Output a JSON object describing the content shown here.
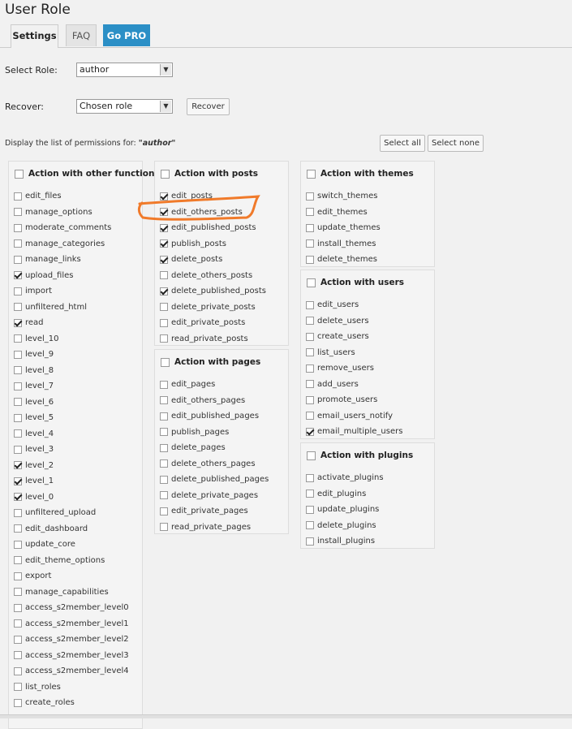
{
  "page": {
    "title": "User Role"
  },
  "tabs": [
    {
      "label": "Settings",
      "active": true
    },
    {
      "label": "FAQ"
    },
    {
      "label": "Go PRO"
    }
  ],
  "form": {
    "role_label": "Select Role:",
    "role_value": "author",
    "recover_label": "Recover:",
    "recover_value": "Chosen role",
    "recover_button": "Recover",
    "select_all": "Select all",
    "select_none": "Select none",
    "hint_prefix": "Display the list of permissions for: ",
    "hint_role": "\"author\""
  },
  "colors": {
    "annotation": "#f07a2a",
    "pro_tab": "#2b8fc6"
  },
  "groups": [
    {
      "title": "Action with other function",
      "items": [
        {
          "label": "edit_files",
          "checked": false
        },
        {
          "label": "manage_options",
          "checked": false
        },
        {
          "label": "moderate_comments",
          "checked": false
        },
        {
          "label": "manage_categories",
          "checked": false
        },
        {
          "label": "manage_links",
          "checked": false
        },
        {
          "label": "upload_files",
          "checked": true
        },
        {
          "label": "import",
          "checked": false
        },
        {
          "label": "unfiltered_html",
          "checked": false
        },
        {
          "label": "read",
          "checked": true
        },
        {
          "label": "level_10",
          "checked": false
        },
        {
          "label": "level_9",
          "checked": false
        },
        {
          "label": "level_8",
          "checked": false
        },
        {
          "label": "level_7",
          "checked": false
        },
        {
          "label": "level_6",
          "checked": false
        },
        {
          "label": "level_5",
          "checked": false
        },
        {
          "label": "level_4",
          "checked": false
        },
        {
          "label": "level_3",
          "checked": false
        },
        {
          "label": "level_2",
          "checked": true
        },
        {
          "label": "level_1",
          "checked": true
        },
        {
          "label": "level_0",
          "checked": true
        },
        {
          "label": "unfiltered_upload",
          "checked": false
        },
        {
          "label": "edit_dashboard",
          "checked": false
        },
        {
          "label": "update_core",
          "checked": false
        },
        {
          "label": "edit_theme_options",
          "checked": false
        },
        {
          "label": "export",
          "checked": false
        },
        {
          "label": "manage_capabilities",
          "checked": false
        },
        {
          "label": "access_s2member_level0",
          "checked": false
        },
        {
          "label": "access_s2member_level1",
          "checked": false
        },
        {
          "label": "access_s2member_level2",
          "checked": false
        },
        {
          "label": "access_s2member_level3",
          "checked": false
        },
        {
          "label": "access_s2member_level4",
          "checked": false
        },
        {
          "label": "list_roles",
          "checked": false
        },
        {
          "label": "create_roles",
          "checked": false
        }
      ]
    },
    {
      "title": "Action with posts",
      "items": [
        {
          "label": "edit_posts",
          "checked": true
        },
        {
          "label": "edit_others_posts",
          "checked": true,
          "highlighted": true
        },
        {
          "label": "edit_published_posts",
          "checked": true
        },
        {
          "label": "publish_posts",
          "checked": true
        },
        {
          "label": "delete_posts",
          "checked": true
        },
        {
          "label": "delete_others_posts",
          "checked": false
        },
        {
          "label": "delete_published_posts",
          "checked": true
        },
        {
          "label": "delete_private_posts",
          "checked": false
        },
        {
          "label": "edit_private_posts",
          "checked": false
        },
        {
          "label": "read_private_posts",
          "checked": false
        }
      ]
    },
    {
      "title": "Action with pages",
      "items": [
        {
          "label": "edit_pages",
          "checked": false
        },
        {
          "label": "edit_others_pages",
          "checked": false
        },
        {
          "label": "edit_published_pages",
          "checked": false
        },
        {
          "label": "publish_pages",
          "checked": false
        },
        {
          "label": "delete_pages",
          "checked": false
        },
        {
          "label": "delete_others_pages",
          "checked": false
        },
        {
          "label": "delete_published_pages",
          "checked": false
        },
        {
          "label": "delete_private_pages",
          "checked": false
        },
        {
          "label": "edit_private_pages",
          "checked": false
        },
        {
          "label": "read_private_pages",
          "checked": false
        }
      ]
    },
    {
      "title": "Action with themes",
      "items": [
        {
          "label": "switch_themes",
          "checked": false
        },
        {
          "label": "edit_themes",
          "checked": false
        },
        {
          "label": "update_themes",
          "checked": false
        },
        {
          "label": "install_themes",
          "checked": false
        },
        {
          "label": "delete_themes",
          "checked": false
        }
      ]
    },
    {
      "title": "Action with users",
      "items": [
        {
          "label": "edit_users",
          "checked": false
        },
        {
          "label": "delete_users",
          "checked": false
        },
        {
          "label": "create_users",
          "checked": false
        },
        {
          "label": "list_users",
          "checked": false
        },
        {
          "label": "remove_users",
          "checked": false
        },
        {
          "label": "add_users",
          "checked": false
        },
        {
          "label": "promote_users",
          "checked": false
        },
        {
          "label": "email_users_notify",
          "checked": false
        },
        {
          "label": "email_multiple_users",
          "checked": true
        }
      ]
    },
    {
      "title": "Action with plugins",
      "items": [
        {
          "label": "activate_plugins",
          "checked": false
        },
        {
          "label": "edit_plugins",
          "checked": false
        },
        {
          "label": "update_plugins",
          "checked": false
        },
        {
          "label": "delete_plugins",
          "checked": false
        },
        {
          "label": "install_plugins",
          "checked": false
        }
      ]
    }
  ]
}
